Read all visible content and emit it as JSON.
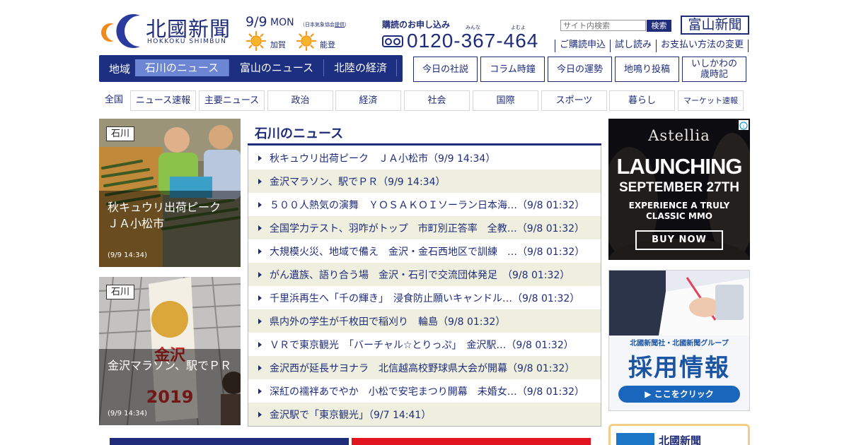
{
  "header": {
    "logo_text": "北國新聞",
    "logo_sub": "HOKKOKU SHIMBUN",
    "date": "9/9",
    "weekday": "MON",
    "weather_credit_prefix": "（日本気象協会",
    "weather_credit_link": "提供",
    "weather_credit_suffix": "）",
    "weather": [
      {
        "label": "加賀",
        "icon": "sunny-icon"
      },
      {
        "label": "能登",
        "icon": "sunny-icon"
      }
    ],
    "subscribe_label": "購読のお申し込み",
    "ruby_minna": "みんな",
    "ruby_yoyo": "よむよ",
    "phone": "0120-367-464",
    "search_placeholder": "サイト内検索",
    "search_button": "検索",
    "toyama_button": "富山新聞",
    "service_links": [
      "ご購読申込",
      "試し読み",
      "お支払い方法の変更"
    ]
  },
  "region_nav": {
    "label": "地域",
    "tabs": [
      "石川のニュース",
      "富山のニュース",
      "北陸の経済"
    ],
    "active": "石川のニュース"
  },
  "feature_buttons": [
    {
      "label": "今日の社説"
    },
    {
      "label": "コラム時鐘"
    },
    {
      "label": "今日の運勢"
    },
    {
      "label": "地鳴り投稿"
    },
    {
      "label": "いしかわの",
      "label2": "歳時記"
    }
  ],
  "category_nav": {
    "all": "全国",
    "items": [
      "ニュース速報",
      "主要ニュース",
      "政治",
      "経済",
      "社会",
      "国際",
      "スポーツ",
      "暮らし",
      "マーケット速報"
    ]
  },
  "photo_cards": [
    {
      "tag": "石川",
      "title": "秋キュウリ出荷ピーク　ＪＡ小松市",
      "time": "(9/9 14:34)"
    },
    {
      "tag": "石川",
      "title": "金沢マラソン、駅でＰＲ",
      "time": "(9/9 14:34)"
    }
  ],
  "news": {
    "heading": "石川のニュース",
    "items": [
      "秋キュウリ出荷ピーク　ＪＡ小松市（9/9 14:34）",
      "金沢マラソン、駅でＰＲ（9/9 14:34）",
      "５００人熱気の演舞　ＹＯＳＡＫＯＩソーラン日本海…（9/8 01:32）",
      "全国学力テスト、羽咋がトップ　市町別正答率　全教…（9/8 01:32）",
      "大規模火災、地域で備え　金沢・金石西地区で訓練　…（9/8 01:32）",
      "がん遺族、語り合う場　金沢・石引で交流団体発足　（9/8 01:32）",
      "千里浜再生へ「千の輝き」　浸食防止願いキャンドル…（9/8 01:32）",
      "県内外の学生が千枚田で稲刈り　輪島（9/8 01:32）",
      "ＶＲで東京観光　「バーチャル☆とりっぷ」　金沢駅…（9/8 01:32）",
      "金沢西が延長サヨナラ　北信越高校野球県大会が開幕（9/8 01:32）",
      "深紅の襦袢あでやか　小松で安宅まつり開幕　未婚女…（9/8 01:32）",
      "金沢駅で「東京観光」（9/7 14:41）"
    ]
  },
  "ads": {
    "game": {
      "brand": "Astellia",
      "headline": "LAUNCHING",
      "date": "SEPTEMBER 27TH",
      "line1": "EXPERIENCE A TRULY",
      "line2": "CLASSIC MMO",
      "cta": "BUY NOW"
    },
    "recruit": {
      "sub": "北國新聞社・北國新聞グループ",
      "title": "採用情報",
      "cta": "▶ ここをクリック"
    },
    "paper": {
      "label": "北國新聞"
    }
  },
  "colors": {
    "brand": "#1f2c7a",
    "nav_bg": "#1c2f80",
    "nav_active": "#6d86d3",
    "row_alt": "#efefdf"
  }
}
